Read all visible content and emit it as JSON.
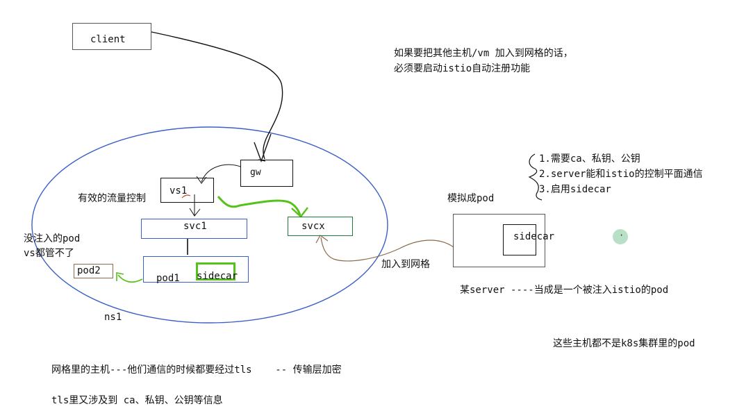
{
  "labels": {
    "client": "client",
    "gw": "gw",
    "vs1": "vs1",
    "svc1": "svc1",
    "svcx": "svcx",
    "pod1": "pod1",
    "pod1_sidecar": "sidecar",
    "pod2": "pod2",
    "ns1": "ns1",
    "effective_traffic": "有效的流量控制",
    "not_injected_1": "没注入的pod",
    "not_injected_2": "vs都管不了",
    "simulate_pod": "模拟成pod",
    "external_sidecar": "sidecar",
    "join_mesh": "加入到网格",
    "server_note": "某server ----当成是一个被注入istio的pod",
    "not_k8s": "这些主机都不是k8s集群里的pod",
    "top_note_1": "如果要把其他主机/vm 加入到网格的话，",
    "top_note_2": "必须要启动istio自动注册功能",
    "req_1": "1.需要ca、私钥、公钥",
    "req_2": "2.server能和istio的控制平面通信",
    "req_3": "3.启用sidecar",
    "bottom_1": "网格里的主机---他们通信的时候都要经过tls    -- 传输层加密",
    "bottom_2": "tls里又涉及到 ca、私钥、公钥等信息",
    "cursor_mark": "·"
  },
  "colors": {
    "black": "#111111",
    "blue": "#3b5fc8",
    "green": "#1f7a3a",
    "bright_green": "#55c21a",
    "brown": "#8a6a4a",
    "gray": "#555555",
    "cursor": "#b9e0c7"
  }
}
